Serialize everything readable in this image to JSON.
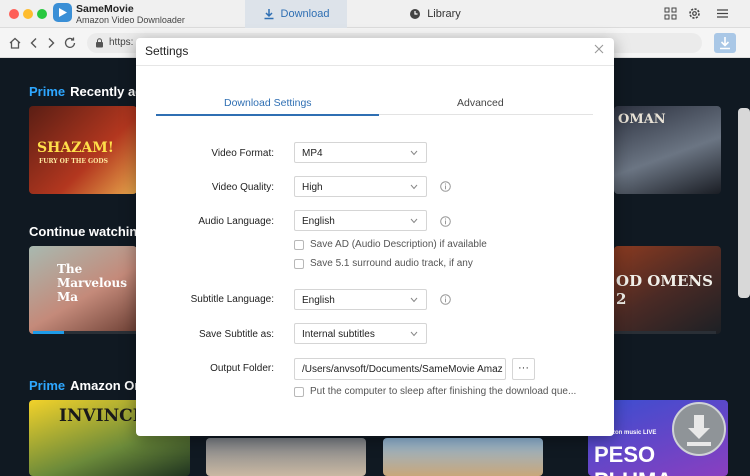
{
  "app": {
    "name": "SameMovie",
    "subtitle": "Amazon Video Downloader"
  },
  "tabs": [
    {
      "label": "Download",
      "active": true
    },
    {
      "label": "Library",
      "active": false
    }
  ],
  "browser": {
    "url_partial": "https:"
  },
  "background": {
    "rows": [
      {
        "prime": "Prime",
        "title": "Recently ad"
      },
      {
        "title": "Continue watching"
      },
      {
        "prime": "Prime",
        "title": "Amazon Or"
      }
    ],
    "tiles": {
      "shazam": "SHAZAM!",
      "shazam_sub": "FURY OF THE GODS",
      "marvelous": "The Marvelous Ma",
      "catwoman": "OMAN",
      "goodomens": "OD OMENS 2",
      "invincible": "INVINCIB",
      "peso": "PESO PLUMA",
      "peso_sub": "amazon music LIVE"
    }
  },
  "settings": {
    "title": "Settings",
    "tabs": {
      "active": "Download Settings",
      "inactive": "Advanced"
    },
    "video_format": {
      "label": "Video Format:",
      "value": "MP4"
    },
    "video_quality": {
      "label": "Video Quality:",
      "value": "High"
    },
    "audio_language": {
      "label": "Audio Language:",
      "value": "English"
    },
    "save_ad": "Save AD (Audio Description) if available",
    "save_51": "Save 5.1 surround audio track, if any",
    "subtitle_language": {
      "label": "Subtitle Language:",
      "value": "English"
    },
    "save_subtitle": {
      "label": "Save Subtitle as:",
      "value": "Internal subtitles"
    },
    "output_folder": {
      "label": "Output Folder:",
      "value": "/Users/anvsoft/Documents/SameMovie Amaz",
      "browse": "···"
    },
    "sleep": "Put the computer to sleep after finishing the download que..."
  },
  "colors": {
    "accent": "#2f6fb3",
    "prime": "#2ea7ff"
  }
}
